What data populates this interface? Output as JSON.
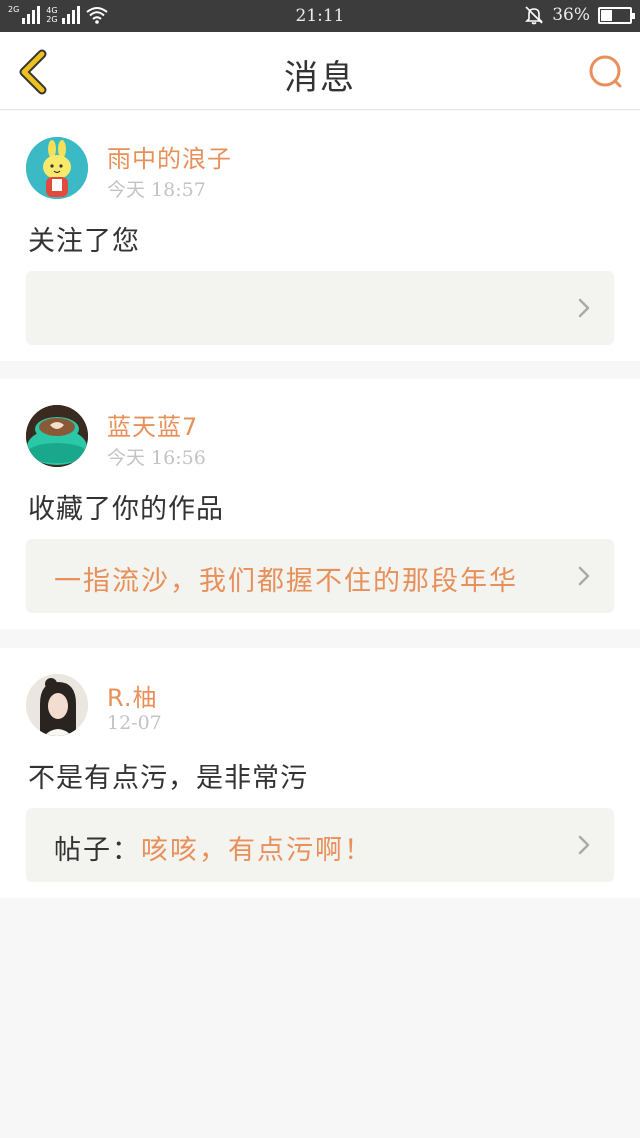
{
  "status_bar": {
    "network_1": "2G",
    "network_2a": "4G",
    "network_2b": "2G",
    "time": "21:11",
    "battery_pct": "36%",
    "battery_level": 0.36
  },
  "header": {
    "title": "消息",
    "back_icon": "chevron-left-icon",
    "search_icon": "search-icon"
  },
  "colors": {
    "accent": "#e8905a",
    "back_arrow": "#f0c020",
    "text": "#333333",
    "muted": "#c3c3c3",
    "card_ref_bg": "#f3f3ef"
  },
  "messages": [
    {
      "user": "雨中的浪子",
      "time": "今天 18:57",
      "action": "关注了您",
      "ref_prefix": "",
      "ref_text": ""
    },
    {
      "user": "蓝天蓝7",
      "time": "今天 16:56",
      "action": "收藏了你的作品",
      "ref_prefix": "",
      "ref_text": "一指流沙，我们都握不住的那段年华"
    },
    {
      "user": "R.柚",
      "time": "12-07",
      "action": "不是有点污，是非常污",
      "ref_prefix": "帖子：",
      "ref_text": "咳咳，有点污啊！"
    }
  ]
}
